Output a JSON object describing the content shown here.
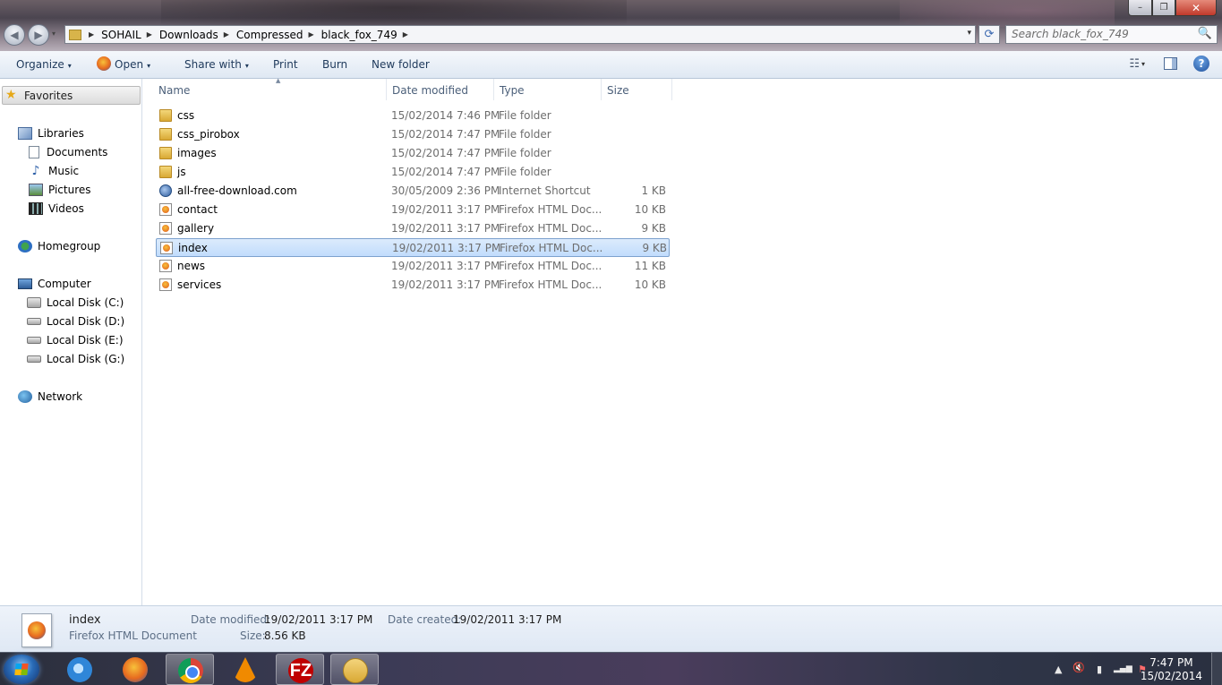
{
  "window": {
    "min": "–",
    "max": "❐",
    "close": "✕"
  },
  "nav": {
    "back": "◀",
    "forward": "▶",
    "recent_caret": "▾"
  },
  "address": {
    "crumbs": [
      "SOHAIL",
      "Downloads",
      "Compressed",
      "black_fox_749"
    ],
    "sep": "▶",
    "dropdown": "▾",
    "refresh": "⟳"
  },
  "search": {
    "placeholder": "Search black_fox_749",
    "icon": "🔍"
  },
  "toolbar": {
    "organize": "Organize",
    "open": "Open",
    "share_with": "Share with",
    "print": "Print",
    "burn": "Burn",
    "new_folder": "New folder",
    "caret": "▾",
    "views_icon": "☷",
    "help": "?"
  },
  "sidebar": {
    "favorites": "Favorites",
    "libraries": "Libraries",
    "documents": "Documents",
    "music": "Music",
    "pictures": "Pictures",
    "videos": "Videos",
    "homegroup": "Homegroup",
    "computer": "Computer",
    "disk_c": "Local Disk (C:)",
    "disk_d": "Local Disk (D:)",
    "disk_e": "Local Disk (E:)",
    "disk_g": "Local Disk (G:)",
    "network": "Network"
  },
  "columns": {
    "name": "Name",
    "date": "Date modified",
    "type": "Type",
    "size": "Size",
    "sort_arrow": "▲"
  },
  "files": [
    {
      "name": "css",
      "date": "15/02/2014 7:46 PM",
      "type": "File folder",
      "size": "",
      "icon": "folder-icon"
    },
    {
      "name": "css_pirobox",
      "date": "15/02/2014 7:47 PM",
      "type": "File folder",
      "size": "",
      "icon": "folder-icon"
    },
    {
      "name": "images",
      "date": "15/02/2014 7:47 PM",
      "type": "File folder",
      "size": "",
      "icon": "folder-icon"
    },
    {
      "name": "js",
      "date": "15/02/2014 7:47 PM",
      "type": "File folder",
      "size": "",
      "icon": "folder-icon"
    },
    {
      "name": "all-free-download.com",
      "date": "30/05/2009 2:36 PM",
      "type": "Internet Shortcut",
      "size": "1 KB",
      "icon": "internet-shortcut-icon"
    },
    {
      "name": "contact",
      "date": "19/02/2011 3:17 PM",
      "type": "Firefox HTML Doc...",
      "size": "10 KB",
      "icon": "firefox-html-icon"
    },
    {
      "name": "gallery",
      "date": "19/02/2011 3:17 PM",
      "type": "Firefox HTML Doc...",
      "size": "9 KB",
      "icon": "firefox-html-icon"
    },
    {
      "name": "index",
      "date": "19/02/2011 3:17 PM",
      "type": "Firefox HTML Doc...",
      "size": "9 KB",
      "icon": "firefox-html-icon",
      "selected": true
    },
    {
      "name": "news",
      "date": "19/02/2011 3:17 PM",
      "type": "Firefox HTML Doc...",
      "size": "11 KB",
      "icon": "firefox-html-icon"
    },
    {
      "name": "services",
      "date": "19/02/2011 3:17 PM",
      "type": "Firefox HTML Doc...",
      "size": "10 KB",
      "icon": "firefox-html-icon"
    }
  ],
  "details": {
    "name": "index",
    "type": "Firefox HTML Document",
    "modified_label": "Date modified:",
    "modified_value": "19/02/2011 3:17 PM",
    "created_label": "Date created:",
    "created_value": "19/02/2011 3:17 PM",
    "size_label": "Size:",
    "size_value": "8.56 KB"
  },
  "taskbar": {
    "filezilla_label": "FZ",
    "tray_up": "▲",
    "tray_volume": "🔇",
    "tray_battery": "▮",
    "tray_signal": "▂▄▆",
    "tray_flag": "⚑",
    "time": "7:47 PM",
    "date": "15/02/2014"
  }
}
